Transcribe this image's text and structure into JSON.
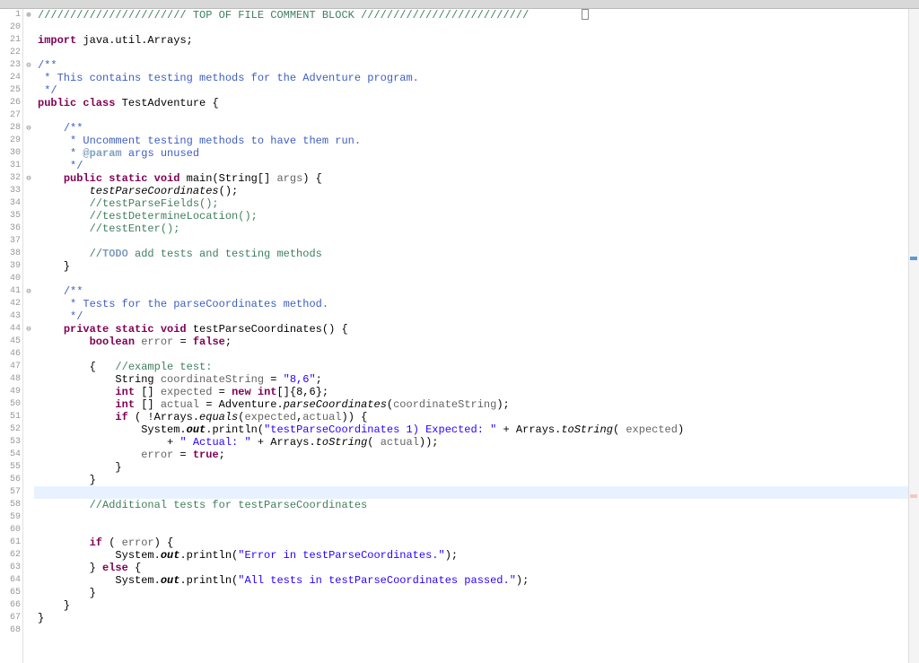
{
  "lineStart": 1,
  "currentLine": 57,
  "foldMarkers": {
    "1": "⊕",
    "23": "⊖",
    "28": "⊖",
    "32": "⊖",
    "41": "⊖",
    "44": "⊖"
  },
  "code": {
    "l1": {
      "segments": [
        {
          "t": "/////////////////////// TOP OF FILE COMMENT BLOCK //////////////////////////",
          "c": "cm"
        }
      ]
    },
    "l20": {
      "segments": []
    },
    "l21": {
      "segments": [
        {
          "t": "import",
          "c": "kw"
        },
        {
          "t": " java.util.Arrays;",
          "c": ""
        }
      ]
    },
    "l22": {
      "segments": []
    },
    "l23": {
      "segments": [
        {
          "t": "/**",
          "c": "jd"
        }
      ]
    },
    "l24": {
      "segments": [
        {
          "t": " * This contains testing methods for the Adventure program.",
          "c": "jd"
        }
      ]
    },
    "l25": {
      "segments": [
        {
          "t": " */",
          "c": "jd"
        }
      ]
    },
    "l26": {
      "segments": [
        {
          "t": "public class",
          "c": "kw"
        },
        {
          "t": " TestAdventure {",
          "c": ""
        }
      ]
    },
    "l27": {
      "segments": []
    },
    "l28": {
      "segments": [
        {
          "t": "    ",
          "c": ""
        },
        {
          "t": "/**",
          "c": "jd"
        }
      ]
    },
    "l29": {
      "segments": [
        {
          "t": "     * Uncomment testing methods to have them run.",
          "c": "jd"
        }
      ]
    },
    "l30": {
      "segments": [
        {
          "t": "     * ",
          "c": "jd"
        },
        {
          "t": "@param",
          "c": "jdt"
        },
        {
          "t": " args unused",
          "c": "jd"
        }
      ]
    },
    "l31": {
      "segments": [
        {
          "t": "     */",
          "c": "jd"
        }
      ]
    },
    "l32": {
      "segments": [
        {
          "t": "    ",
          "c": ""
        },
        {
          "t": "public static void",
          "c": "kw"
        },
        {
          "t": " main(String[] ",
          "c": ""
        },
        {
          "t": "args",
          "c": "ann"
        },
        {
          "t": ") {",
          "c": ""
        }
      ]
    },
    "l33": {
      "segments": [
        {
          "t": "        ",
          "c": ""
        },
        {
          "t": "testParseCoordinates",
          "c": "it"
        },
        {
          "t": "();",
          "c": ""
        }
      ]
    },
    "l34": {
      "segments": [
        {
          "t": "        ",
          "c": ""
        },
        {
          "t": "//testParseFields();",
          "c": "cm"
        }
      ]
    },
    "l35": {
      "segments": [
        {
          "t": "        ",
          "c": ""
        },
        {
          "t": "//testDetermineLocation();",
          "c": "cm"
        }
      ]
    },
    "l36": {
      "segments": [
        {
          "t": "        ",
          "c": ""
        },
        {
          "t": "//testEnter();",
          "c": "cm"
        }
      ]
    },
    "l37": {
      "segments": []
    },
    "l38": {
      "segments": [
        {
          "t": "        ",
          "c": ""
        },
        {
          "t": "//",
          "c": "cm"
        },
        {
          "t": "TODO",
          "c": "todo"
        },
        {
          "t": " add tests and testing methods",
          "c": "cm"
        }
      ]
    },
    "l39": {
      "segments": [
        {
          "t": "    }",
          "c": ""
        }
      ]
    },
    "l40": {
      "segments": []
    },
    "l41": {
      "segments": [
        {
          "t": "    ",
          "c": ""
        },
        {
          "t": "/**",
          "c": "jd"
        }
      ]
    },
    "l42": {
      "segments": [
        {
          "t": "     * Tests for the parseCoordinates method.",
          "c": "jd"
        }
      ]
    },
    "l43": {
      "segments": [
        {
          "t": "     */",
          "c": "jd"
        }
      ]
    },
    "l44": {
      "segments": [
        {
          "t": "    ",
          "c": ""
        },
        {
          "t": "private static void",
          "c": "kw"
        },
        {
          "t": " testParseCoordinates() {",
          "c": ""
        }
      ]
    },
    "l45": {
      "segments": [
        {
          "t": "        ",
          "c": ""
        },
        {
          "t": "boolean",
          "c": "kw"
        },
        {
          "t": " ",
          "c": ""
        },
        {
          "t": "error",
          "c": "ann"
        },
        {
          "t": " = ",
          "c": ""
        },
        {
          "t": "false",
          "c": "kw"
        },
        {
          "t": ";",
          "c": ""
        }
      ]
    },
    "l46": {
      "segments": []
    },
    "l47": {
      "segments": [
        {
          "t": "        {   ",
          "c": ""
        },
        {
          "t": "//example test:",
          "c": "cm"
        }
      ]
    },
    "l48": {
      "segments": [
        {
          "t": "            String ",
          "c": ""
        },
        {
          "t": "coordinateString",
          "c": "ann"
        },
        {
          "t": " = ",
          "c": ""
        },
        {
          "t": "\"8,6\"",
          "c": "str"
        },
        {
          "t": ";",
          "c": ""
        }
      ]
    },
    "l49": {
      "segments": [
        {
          "t": "            ",
          "c": ""
        },
        {
          "t": "int",
          "c": "kw"
        },
        {
          "t": " [] ",
          "c": ""
        },
        {
          "t": "expected",
          "c": "ann"
        },
        {
          "t": " = ",
          "c": ""
        },
        {
          "t": "new int",
          "c": "kw"
        },
        {
          "t": "[]{8,6};",
          "c": ""
        }
      ]
    },
    "l50": {
      "segments": [
        {
          "t": "            ",
          "c": ""
        },
        {
          "t": "int",
          "c": "kw"
        },
        {
          "t": " [] ",
          "c": ""
        },
        {
          "t": "actual",
          "c": "ann"
        },
        {
          "t": " = Adventure.",
          "c": ""
        },
        {
          "t": "parseCoordinates",
          "c": "it"
        },
        {
          "t": "(",
          "c": ""
        },
        {
          "t": "coordinateString",
          "c": "ann"
        },
        {
          "t": ");",
          "c": ""
        }
      ]
    },
    "l51": {
      "segments": [
        {
          "t": "            ",
          "c": ""
        },
        {
          "t": "if",
          "c": "kw"
        },
        {
          "t": " ( !Arrays.",
          "c": ""
        },
        {
          "t": "equals",
          "c": "it"
        },
        {
          "t": "(",
          "c": ""
        },
        {
          "t": "expected",
          "c": "ann"
        },
        {
          "t": ",",
          "c": ""
        },
        {
          "t": "actual",
          "c": "ann"
        },
        {
          "t": ")) {",
          "c": ""
        }
      ]
    },
    "l52": {
      "segments": [
        {
          "t": "                System.",
          "c": ""
        },
        {
          "t": "out",
          "c": "it bld"
        },
        {
          "t": ".println(",
          "c": ""
        },
        {
          "t": "\"testParseCoordinates 1) Expected: \"",
          "c": "str"
        },
        {
          "t": " + Arrays.",
          "c": ""
        },
        {
          "t": "toString",
          "c": "it"
        },
        {
          "t": "( ",
          "c": ""
        },
        {
          "t": "expected",
          "c": "ann"
        },
        {
          "t": ")",
          "c": ""
        }
      ]
    },
    "l53": {
      "segments": [
        {
          "t": "                    + ",
          "c": ""
        },
        {
          "t": "\" Actual: \"",
          "c": "str"
        },
        {
          "t": " + Arrays.",
          "c": ""
        },
        {
          "t": "toString",
          "c": "it"
        },
        {
          "t": "( ",
          "c": ""
        },
        {
          "t": "actual",
          "c": "ann"
        },
        {
          "t": "));",
          "c": ""
        }
      ]
    },
    "l54": {
      "segments": [
        {
          "t": "                ",
          "c": ""
        },
        {
          "t": "error",
          "c": "ann"
        },
        {
          "t": " = ",
          "c": ""
        },
        {
          "t": "true",
          "c": "kw"
        },
        {
          "t": ";",
          "c": ""
        }
      ]
    },
    "l55": {
      "segments": [
        {
          "t": "            }",
          "c": ""
        }
      ]
    },
    "l56": {
      "segments": [
        {
          "t": "        }",
          "c": ""
        }
      ]
    },
    "l57": {
      "segments": []
    },
    "l58": {
      "segments": [
        {
          "t": "        ",
          "c": ""
        },
        {
          "t": "//Additional tests for testParseCoordinates",
          "c": "cm"
        }
      ]
    },
    "l59": {
      "segments": []
    },
    "l60": {
      "segments": []
    },
    "l61": {
      "segments": [
        {
          "t": "        ",
          "c": ""
        },
        {
          "t": "if",
          "c": "kw"
        },
        {
          "t": " ( ",
          "c": ""
        },
        {
          "t": "error",
          "c": "ann"
        },
        {
          "t": ") {",
          "c": ""
        }
      ]
    },
    "l62": {
      "segments": [
        {
          "t": "            System.",
          "c": ""
        },
        {
          "t": "out",
          "c": "it bld"
        },
        {
          "t": ".println(",
          "c": ""
        },
        {
          "t": "\"Error in testParseCoordinates.\"",
          "c": "str"
        },
        {
          "t": ");",
          "c": ""
        }
      ]
    },
    "l63": {
      "segments": [
        {
          "t": "        } ",
          "c": ""
        },
        {
          "t": "else",
          "c": "kw"
        },
        {
          "t": " {",
          "c": ""
        }
      ]
    },
    "l64": {
      "segments": [
        {
          "t": "            System.",
          "c": ""
        },
        {
          "t": "out",
          "c": "it bld"
        },
        {
          "t": ".println(",
          "c": ""
        },
        {
          "t": "\"All tests in testParseCoordinates passed.\"",
          "c": "str"
        },
        {
          "t": ");",
          "c": ""
        }
      ]
    },
    "l65": {
      "segments": [
        {
          "t": "        }",
          "c": ""
        }
      ]
    },
    "l66": {
      "segments": [
        {
          "t": "    }",
          "c": ""
        }
      ]
    },
    "l67": {
      "segments": [
        {
          "t": "}",
          "c": ""
        }
      ]
    },
    "l68": {
      "segments": []
    }
  },
  "lineNumbers": [
    1,
    20,
    21,
    22,
    23,
    24,
    25,
    26,
    27,
    28,
    29,
    30,
    31,
    32,
    33,
    34,
    35,
    36,
    37,
    38,
    39,
    40,
    41,
    42,
    43,
    44,
    45,
    46,
    47,
    48,
    49,
    50,
    51,
    52,
    53,
    54,
    55,
    56,
    57,
    58,
    59,
    60,
    61,
    62,
    63,
    64,
    65,
    66,
    67,
    68
  ]
}
